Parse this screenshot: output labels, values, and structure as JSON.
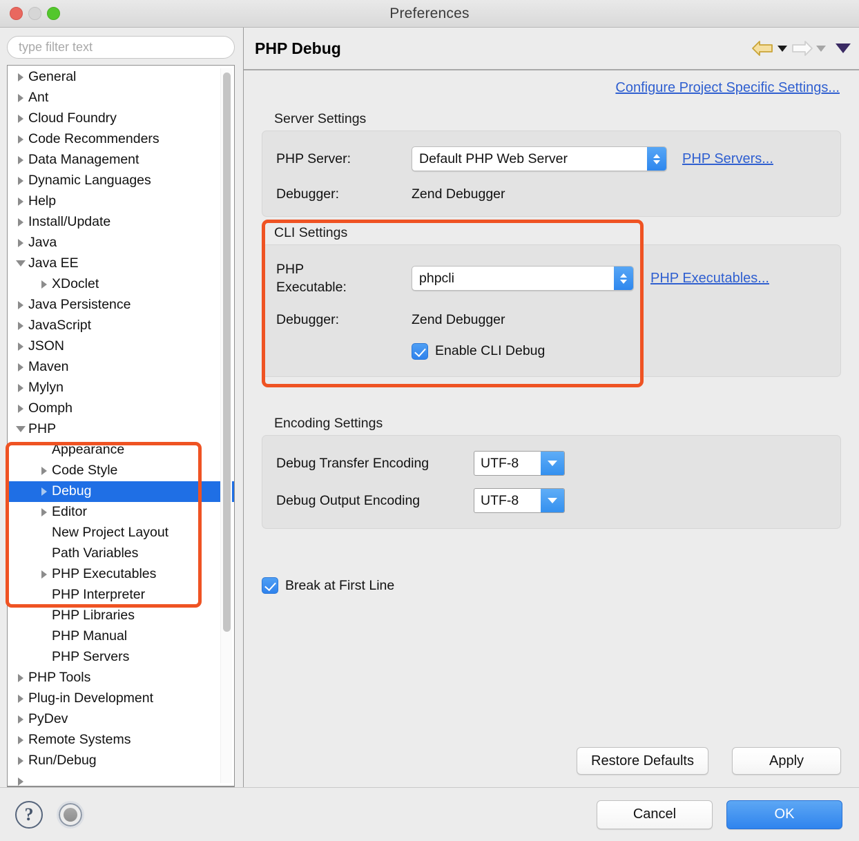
{
  "window": {
    "title": "Preferences",
    "traffic_lights": [
      "close-red",
      "minimize-yellow",
      "zoom-green"
    ]
  },
  "sidebar": {
    "filter": {
      "placeholder": "type filter text",
      "value": ""
    },
    "items": [
      {
        "label": "General",
        "level": 0,
        "twisty": "closed"
      },
      {
        "label": "Ant",
        "level": 0,
        "twisty": "closed"
      },
      {
        "label": "Cloud Foundry",
        "level": 0,
        "twisty": "closed"
      },
      {
        "label": "Code Recommenders",
        "level": 0,
        "twisty": "closed"
      },
      {
        "label": "Data Management",
        "level": 0,
        "twisty": "closed"
      },
      {
        "label": "Dynamic Languages",
        "level": 0,
        "twisty": "closed"
      },
      {
        "label": "Help",
        "level": 0,
        "twisty": "closed"
      },
      {
        "label": "Install/Update",
        "level": 0,
        "twisty": "closed"
      },
      {
        "label": "Java",
        "level": 0,
        "twisty": "closed"
      },
      {
        "label": "Java EE",
        "level": 0,
        "twisty": "open"
      },
      {
        "label": "XDoclet",
        "level": 1,
        "twisty": "closed"
      },
      {
        "label": "Java Persistence",
        "level": 0,
        "twisty": "closed"
      },
      {
        "label": "JavaScript",
        "level": 0,
        "twisty": "closed"
      },
      {
        "label": "JSON",
        "level": 0,
        "twisty": "closed"
      },
      {
        "label": "Maven",
        "level": 0,
        "twisty": "closed"
      },
      {
        "label": "Mylyn",
        "level": 0,
        "twisty": "closed"
      },
      {
        "label": "Oomph",
        "level": 0,
        "twisty": "closed"
      },
      {
        "label": "PHP",
        "level": 0,
        "twisty": "open"
      },
      {
        "label": "Appearance",
        "level": 1,
        "twisty": "none"
      },
      {
        "label": "Code Style",
        "level": 1,
        "twisty": "closed"
      },
      {
        "label": "Debug",
        "level": 1,
        "twisty": "closed",
        "selected": true
      },
      {
        "label": "Editor",
        "level": 1,
        "twisty": "closed"
      },
      {
        "label": "New Project Layout",
        "level": 1,
        "twisty": "none"
      },
      {
        "label": "Path Variables",
        "level": 1,
        "twisty": "none"
      },
      {
        "label": "PHP Executables",
        "level": 1,
        "twisty": "closed"
      },
      {
        "label": "PHP Interpreter",
        "level": 1,
        "twisty": "none"
      },
      {
        "label": "PHP Libraries",
        "level": 1,
        "twisty": "none"
      },
      {
        "label": "PHP Manual",
        "level": 1,
        "twisty": "none"
      },
      {
        "label": "PHP Servers",
        "level": 1,
        "twisty": "none"
      },
      {
        "label": "PHP Tools",
        "level": 0,
        "twisty": "closed"
      },
      {
        "label": "Plug-in Development",
        "level": 0,
        "twisty": "closed"
      },
      {
        "label": "PyDev",
        "level": 0,
        "twisty": "closed"
      },
      {
        "label": "Remote Systems",
        "level": 0,
        "twisty": "closed"
      },
      {
        "label": "Run/Debug",
        "level": 0,
        "twisty": "closed"
      },
      {
        "label": "",
        "level": 0,
        "twisty": "closed"
      }
    ]
  },
  "main": {
    "page_title": "PHP Debug",
    "nav": {
      "back_icon": "back-arrow-icon",
      "back_menu_icon": "chevron-down-icon",
      "forward_icon": "forward-arrow-icon",
      "forward_menu_icon": "chevron-down-icon",
      "view_menu_icon": "chevron-down-icon"
    },
    "configure_link": "Configure Project Specific Settings...",
    "server_settings": {
      "title": "Server Settings",
      "php_server_label": "PHP Server:",
      "php_server_value": "Default PHP Web Server",
      "php_servers_link": "PHP Servers...",
      "debugger_label": "Debugger:",
      "debugger_value": "Zend Debugger"
    },
    "cli_settings": {
      "title": "CLI Settings",
      "php_executable_label": "PHP\nExecutable:",
      "php_executable_line1": "PHP",
      "php_executable_line2": "Executable:",
      "php_executable_value": "phpcli",
      "php_executables_link": "PHP Executables...",
      "debugger_label": "Debugger:",
      "debugger_value": "Zend Debugger",
      "enable_cli_debug_label": "Enable CLI Debug",
      "enable_cli_debug_checked": true
    },
    "encoding_settings": {
      "title": "Encoding Settings",
      "transfer_label": "Debug Transfer Encoding",
      "transfer_value": "UTF-8",
      "output_label": "Debug Output Encoding",
      "output_value": "UTF-8"
    },
    "break_at_first_line_label": "Break at First Line",
    "break_at_first_line_checked": true,
    "restore_defaults_label": "Restore Defaults",
    "apply_label": "Apply"
  },
  "footer": {
    "help_icon": "question-mark-icon",
    "help_glyph": "?",
    "lock_icon": "lock-circle-icon",
    "cancel_label": "Cancel",
    "ok_label": "OK"
  },
  "annotations": {
    "highlight_color": "#ef5323",
    "boxes": [
      "sidebar-php-subtree",
      "cli-settings-group"
    ]
  }
}
